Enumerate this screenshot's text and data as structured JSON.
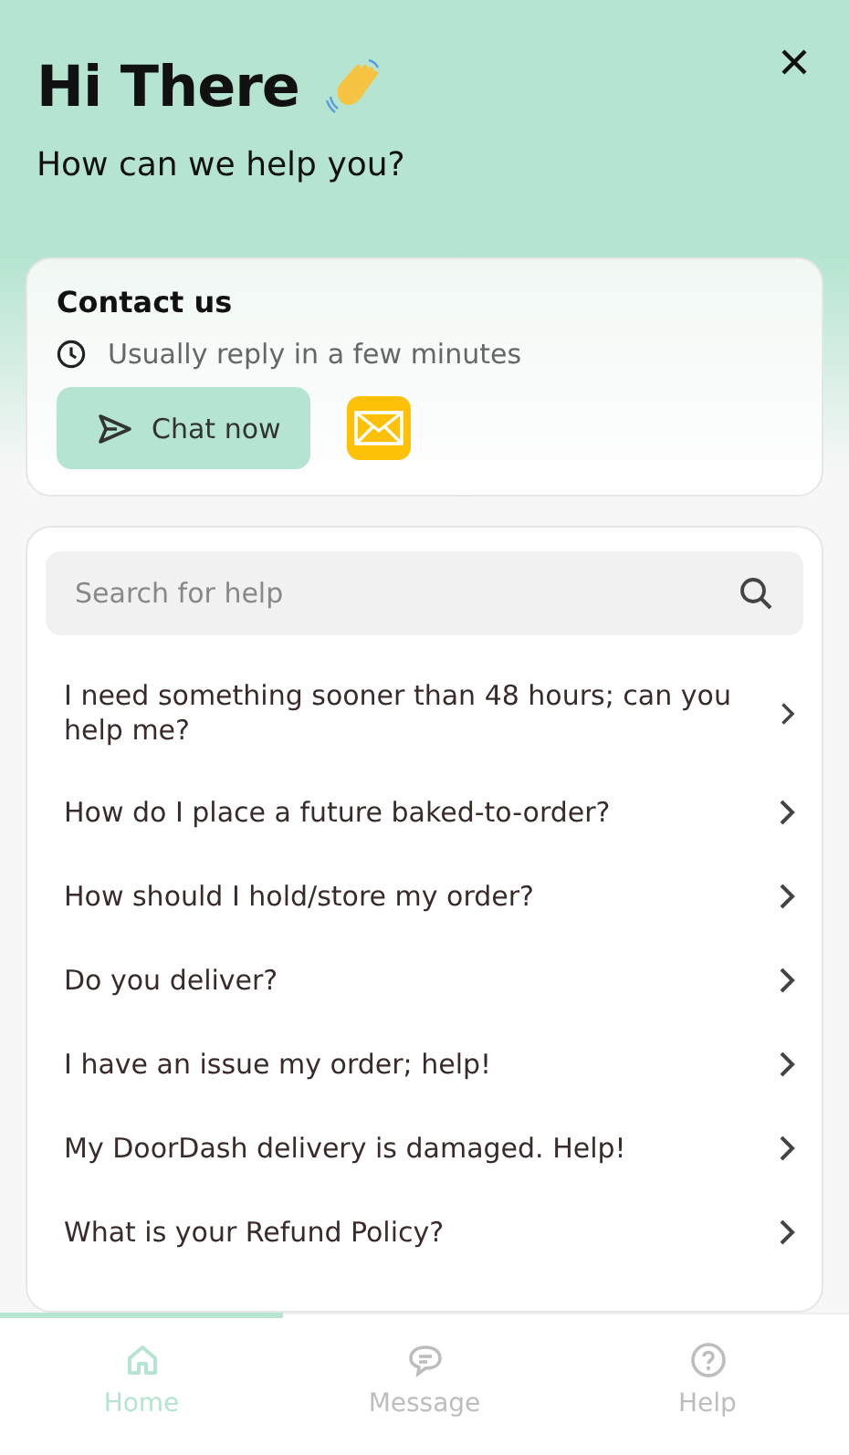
{
  "header": {
    "title": "Hi There",
    "subtitle": "How can we help you?"
  },
  "contact": {
    "title": "Contact us",
    "reply_time": "Usually reply in a few minutes",
    "chat_button": "Chat now"
  },
  "search": {
    "placeholder": "Search for help"
  },
  "questions": [
    {
      "text": "I need something sooner than 48 hours; can you help me?"
    },
    {
      "text": "How do I place a future baked-to-order?"
    },
    {
      "text": "How should I hold/store my order?"
    },
    {
      "text": "Do you deliver?"
    },
    {
      "text": "I have an issue my order; help!"
    },
    {
      "text": "My DoorDash delivery is damaged. Help!"
    },
    {
      "text": "What is your Refund Policy?"
    }
  ],
  "nav": [
    {
      "label": "Home",
      "kind": "home",
      "selected": true
    },
    {
      "label": "Message",
      "kind": "message",
      "selected": false
    },
    {
      "label": "Help",
      "kind": "help",
      "selected": false
    }
  ]
}
